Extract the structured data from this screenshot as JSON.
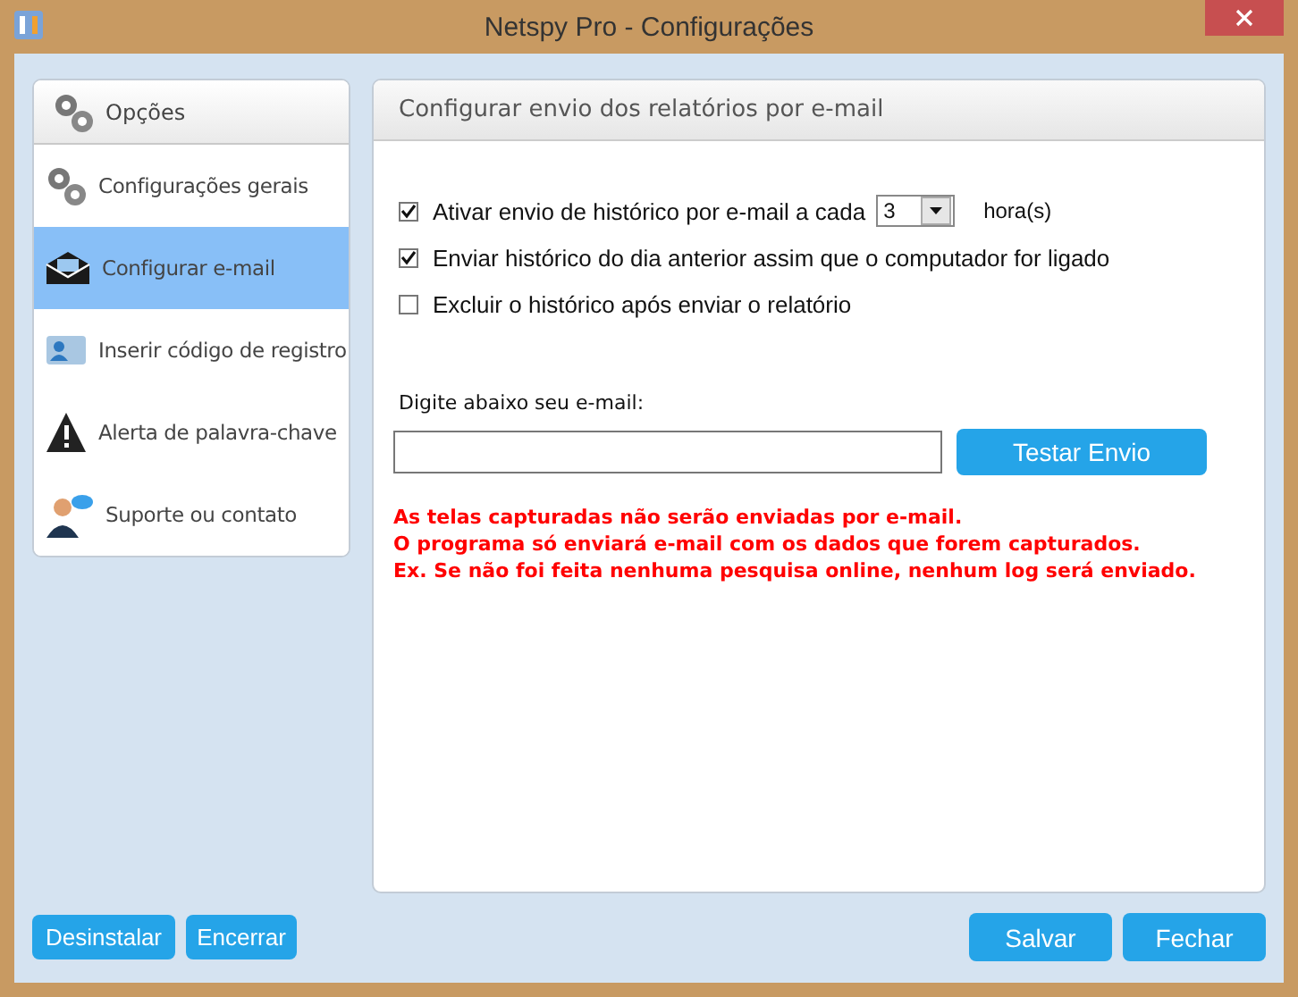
{
  "window": {
    "title": "Netspy Pro - Configurações"
  },
  "sidebar": {
    "header": "Opções",
    "items": [
      {
        "kind": "gears",
        "label": "Configurações gerais",
        "selected": false
      },
      {
        "kind": "mail",
        "label": "Configurar e-mail",
        "selected": true
      },
      {
        "kind": "card",
        "label": "Inserir código de registro",
        "selected": false
      },
      {
        "kind": "warning",
        "label": "Alerta de palavra-chave",
        "selected": false
      },
      {
        "kind": "support",
        "label": "Suporte ou contato",
        "selected": false
      }
    ]
  },
  "panel": {
    "title": "Configurar envio dos relatórios por e-mail",
    "options": [
      {
        "label": "Ativar envio de histórico por e-mail a cada",
        "checked": true,
        "interval": {
          "value": "3",
          "unit": "hora(s)"
        }
      },
      {
        "label": "Enviar histórico do dia anterior assim que o computador for ligado",
        "checked": true
      },
      {
        "label": "Excluir o histórico após enviar o relatório",
        "checked": false
      }
    ],
    "email_label": "Digite abaixo seu e-mail:",
    "test_button": "Testar Envio",
    "notes": [
      "As telas capturadas não serão enviadas por e-mail.",
      "O programa só enviará e-mail com os dados que forem capturados.",
      "Ex. Se não foi feita nenhuma pesquisa online, nenhum log será enviado."
    ]
  },
  "footer": {
    "left_buttons": [
      "Desinstalar",
      "Encerrar"
    ],
    "right_buttons": [
      "Salvar",
      "Fechar"
    ]
  }
}
